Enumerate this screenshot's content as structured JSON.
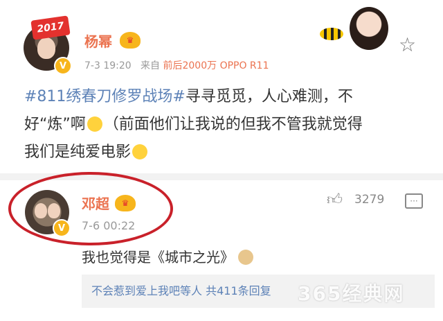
{
  "post": {
    "author": "杨幂",
    "date": "7-3 19:20",
    "source_prefix": "来自",
    "source_device": "前后2000万 OPPO R11",
    "badge_year": "2017",
    "content_topic": "#811绣春刀修罗战场#",
    "content_line1_rest": "寻寻觅觅，人心难测，不",
    "content_line2": "好“炼”啊",
    "content_line2_rest": "（前面他们让我说的但我不管我就觉得",
    "content_line3": "我们是纯爱电影"
  },
  "comment": {
    "author": "邓超",
    "date": "7-6 00:22",
    "likes": "3279",
    "text": "我也觉得是《城市之光》",
    "sub_replies": "不会惹到爱上我吧等人 共411条回复"
  },
  "watermark": "365经典网",
  "colors": {
    "link": "#5d82b7",
    "highlight": "#eb7350",
    "ring": "#c9212a",
    "verified": "#f7b51c"
  }
}
